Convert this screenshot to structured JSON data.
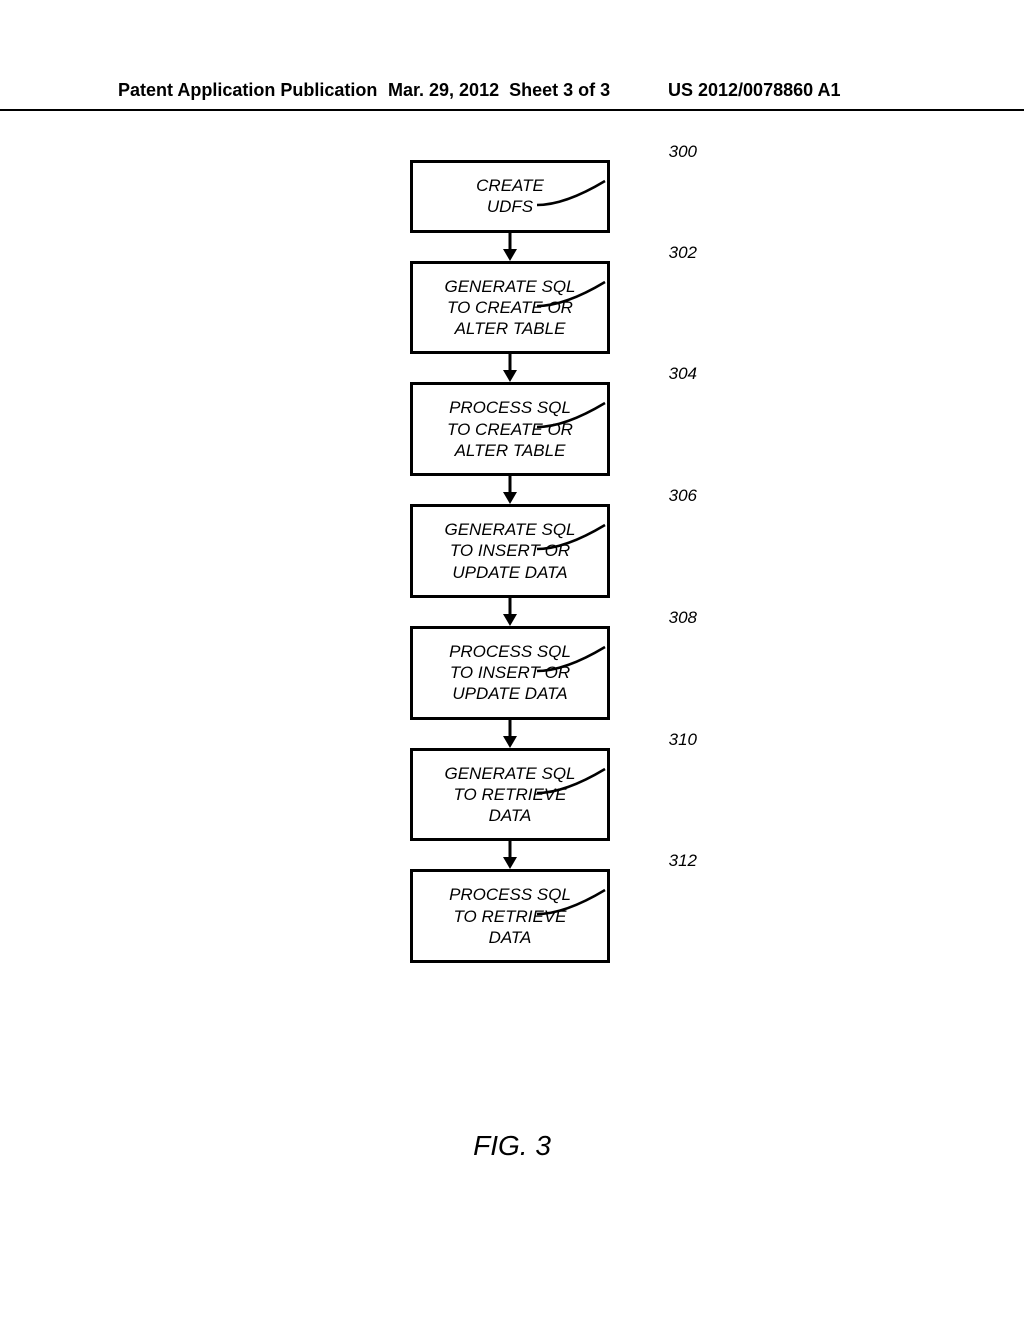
{
  "header": {
    "left": "Patent Application Publication",
    "date": "Mar. 29, 2012",
    "sheet": "Sheet 3 of 3",
    "pubno": "US 2012/0078860 A1"
  },
  "figure_caption": "FIG. 3",
  "steps": [
    {
      "ref": "300",
      "lines": [
        "CREATE",
        "UDFS"
      ]
    },
    {
      "ref": "302",
      "lines": [
        "GENERATE SQL",
        "TO CREATE OR",
        "ALTER TABLE"
      ]
    },
    {
      "ref": "304",
      "lines": [
        "PROCESS SQL",
        "TO CREATE OR",
        "ALTER TABLE"
      ]
    },
    {
      "ref": "306",
      "lines": [
        "GENERATE SQL",
        "TO INSERT OR",
        "UPDATE DATA"
      ]
    },
    {
      "ref": "308",
      "lines": [
        "PROCESS SQL",
        "TO INSERT OR",
        "UPDATE DATA"
      ]
    },
    {
      "ref": "310",
      "lines": [
        "GENERATE SQL",
        "TO RETRIEVE",
        "DATA"
      ]
    },
    {
      "ref": "312",
      "lines": [
        "PROCESS SQL",
        "TO RETRIEVE",
        "DATA"
      ]
    }
  ]
}
